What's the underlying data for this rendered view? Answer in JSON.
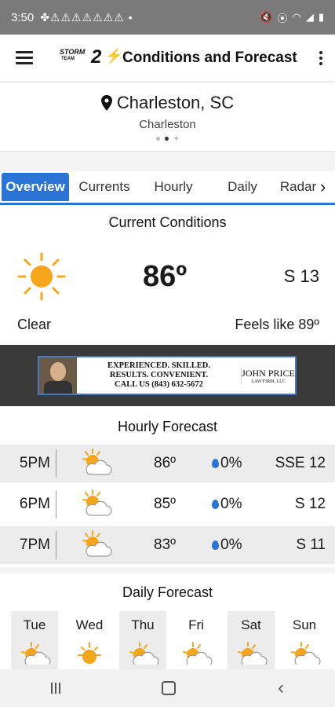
{
  "status_bar": {
    "time": "3:50",
    "notif_icons": "✤⚠⚠⚠⚠⚠⚠⚠ •",
    "right_icons": [
      "mute-icon",
      "location-icon",
      "wifi-icon",
      "signal-icon",
      "battery-icon"
    ]
  },
  "app_bar": {
    "logo_line1": "STORM",
    "logo_line2": "TEAM",
    "logo_number": "2",
    "title": "Conditions and Forecast"
  },
  "location": {
    "name": "Charleston, SC",
    "subtitle": "Charleston"
  },
  "tabs": [
    {
      "label": "Overview",
      "active": true
    },
    {
      "label": "Currents"
    },
    {
      "label": "Hourly"
    },
    {
      "label": "Daily"
    },
    {
      "label": "Radar"
    }
  ],
  "current": {
    "title": "Current Conditions",
    "temp": "86º",
    "wind": "S  13",
    "condition": "Clear",
    "feels_like": "Feels like 89º"
  },
  "ad": {
    "line1": "EXPERIENCED. SKILLED.",
    "line2": "RESULTS. CONVENIENT.",
    "line3": "CALL US (843) 632-5672",
    "brand": "JOHN PRICE",
    "brand_sub": "LAW FIRM, LLC"
  },
  "hourly": {
    "title": "Hourly Forecast",
    "rows": [
      {
        "time": "5PM",
        "temp": "86º",
        "precip": "0%",
        "wind": "SSE 12"
      },
      {
        "time": "6PM",
        "temp": "85º",
        "precip": "0%",
        "wind": "S 12"
      },
      {
        "time": "7PM",
        "temp": "83º",
        "precip": "0%",
        "wind": "S 11"
      }
    ]
  },
  "daily": {
    "title": "Daily Forecast",
    "days": [
      "Tue",
      "Wed",
      "Thu",
      "Fri",
      "Sat",
      "Sun"
    ]
  },
  "colors": {
    "accent": "#2a74d6",
    "sun": "#f7a61c"
  }
}
